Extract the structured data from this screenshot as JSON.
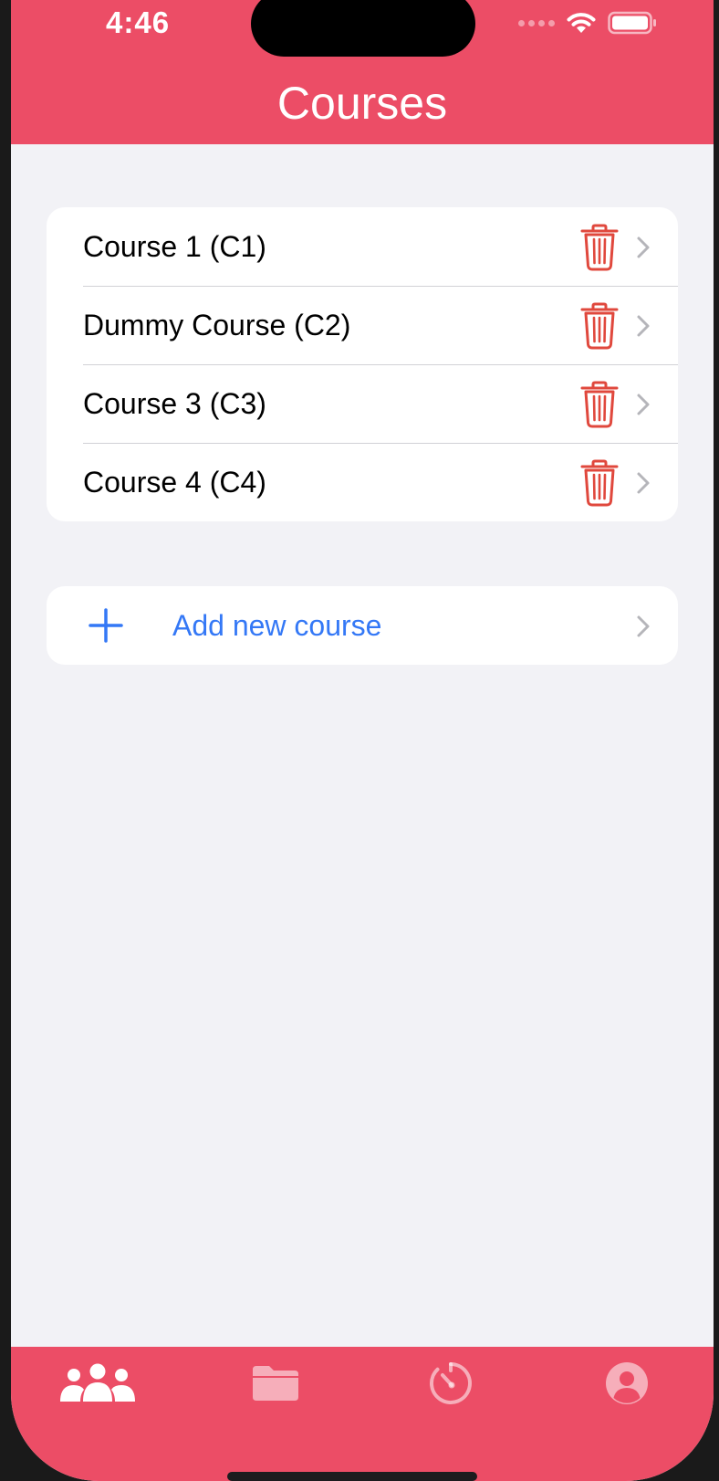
{
  "status_bar": {
    "time": "4:46"
  },
  "header": {
    "title": "Courses"
  },
  "courses": [
    {
      "label": "Course 1 (C1)"
    },
    {
      "label": "Dummy Course (C2)"
    },
    {
      "label": "Course 3 (C3)"
    },
    {
      "label": "Course 4 (C4)"
    }
  ],
  "add_course": {
    "label": "Add new course"
  },
  "tabs": [
    {
      "icon": "people-icon",
      "active": true
    },
    {
      "icon": "folder-icon",
      "active": false
    },
    {
      "icon": "timer-icon",
      "active": false
    },
    {
      "icon": "profile-icon",
      "active": false
    }
  ],
  "colors": {
    "accent": "#ec4d66",
    "destructive": "#e0483d",
    "link": "#3478f6",
    "background": "#f2f2f6"
  }
}
